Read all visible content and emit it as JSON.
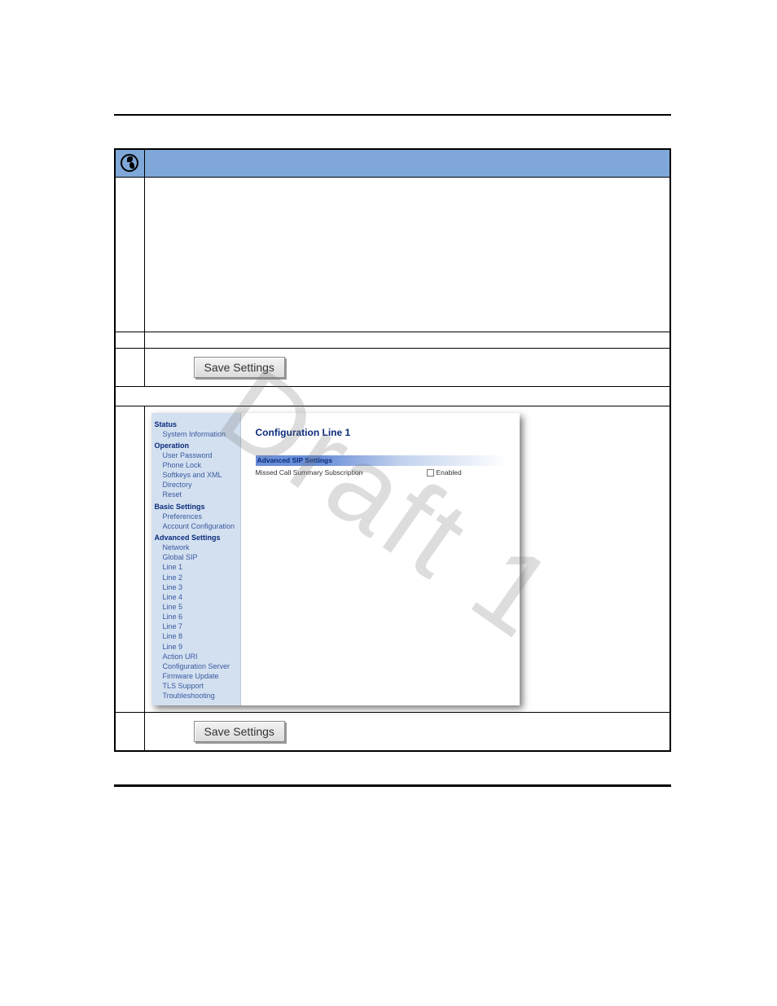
{
  "watermark": "Draft 1",
  "save_button_label": "Save Settings",
  "admin": {
    "title": "Configuration Line 1",
    "section_header": "Advanced SIP Settings",
    "field_label": "Missed Call Summary Subscription",
    "checkbox_label": "Enabled",
    "sidebar": {
      "groups": [
        {
          "header": "Status",
          "items": [
            "System Information"
          ]
        },
        {
          "header": "Operation",
          "items": [
            "User Password",
            "Phone Lock",
            "Softkeys and XML",
            "Directory",
            "Reset"
          ]
        },
        {
          "header": "Basic Settings",
          "items": [
            "Preferences",
            "Account Configuration"
          ]
        },
        {
          "header": "Advanced Settings",
          "items": [
            "Network",
            "Global SIP",
            "Line 1",
            "Line 2",
            "Line 3",
            "Line 4",
            "Line 5",
            "Line 6",
            "Line 7",
            "Line 8",
            "Line 9",
            "Action URI",
            "Configuration Server",
            "Firmware Update",
            "TLS Support",
            "Troubleshooting"
          ]
        }
      ]
    }
  }
}
